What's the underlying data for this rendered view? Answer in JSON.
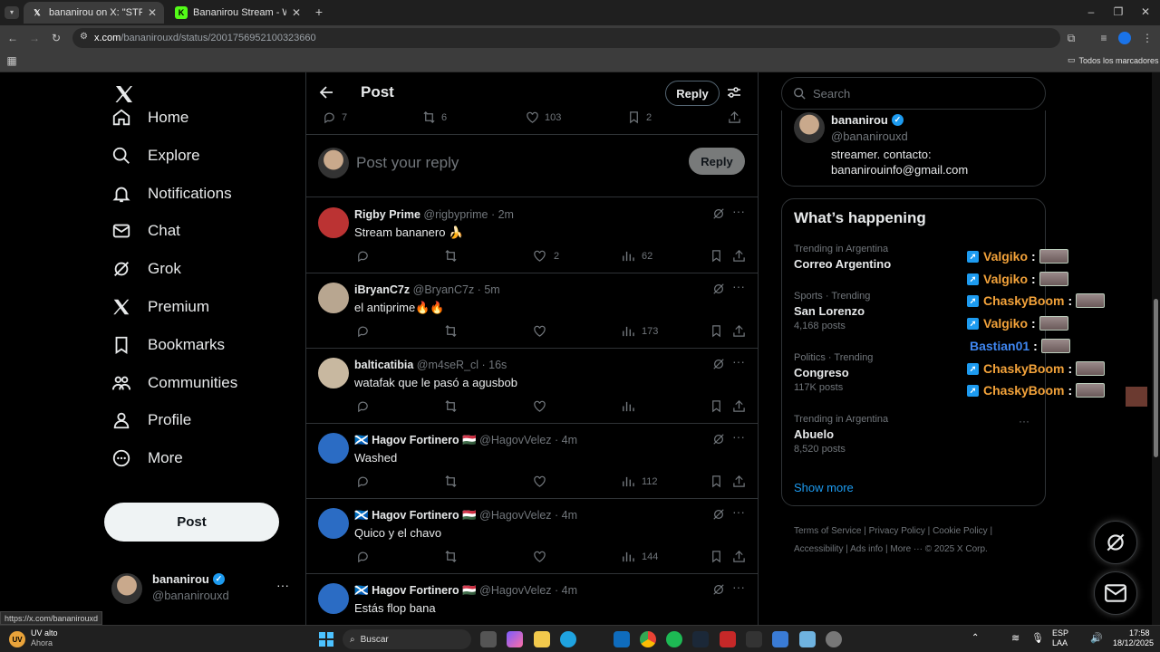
{
  "browser": {
    "tabs": [
      {
        "title": "bananirou on X: \"STREAM ON. I",
        "active": true
      },
      {
        "title": "Bananirou Stream - Watch Live",
        "active": false
      }
    ],
    "url_host": "x.com",
    "url_path": "/bananirouxd/status/2001756952100323660",
    "bookmarks_label": "Todos los marcadores",
    "status_url": "https://x.com/bananirouxd"
  },
  "nav": {
    "items": [
      {
        "label": "Home",
        "icon": "home-icon"
      },
      {
        "label": "Explore",
        "icon": "search-icon"
      },
      {
        "label": "Notifications",
        "icon": "bell-icon"
      },
      {
        "label": "Chat",
        "icon": "envelope-icon"
      },
      {
        "label": "Grok",
        "icon": "grok-icon"
      },
      {
        "label": "Premium",
        "icon": "x-logo-icon"
      },
      {
        "label": "Bookmarks",
        "icon": "bookmark-icon"
      },
      {
        "label": "Communities",
        "icon": "people-icon"
      },
      {
        "label": "Profile",
        "icon": "person-icon"
      },
      {
        "label": "More",
        "icon": "more-circle-icon"
      }
    ],
    "post_label": "Post",
    "user": {
      "name": "bananirou",
      "handle": "@bananirouxd"
    }
  },
  "header": {
    "title": "Post",
    "reply_label": "Reply"
  },
  "metrics": {
    "replies": "7",
    "reposts": "6",
    "likes": "103",
    "bookmarks": "2"
  },
  "compose": {
    "placeholder": "Post your reply",
    "button": "Reply"
  },
  "replies": [
    {
      "name": "Rigby Prime",
      "handle": "@rigbyprime",
      "time": "2m",
      "text": "Stream bananero 🍌",
      "replies": "",
      "reposts": "",
      "likes": "2",
      "views": "62",
      "avatar_color": "#b33"
    },
    {
      "name": "iBryanC7z",
      "handle": "@BryanC7z",
      "time": "5m",
      "text": "el antiprime🔥🔥",
      "replies": "",
      "reposts": "",
      "likes": "",
      "views": "173",
      "avatar_color": "#b8a690"
    },
    {
      "name": "balticatibia",
      "handle": "@m4seR_cl",
      "time": "16s",
      "text": "watafak que le pasó a agusbob",
      "replies": "",
      "reposts": "",
      "likes": "",
      "views": "",
      "avatar_color": "#c8b8a0"
    },
    {
      "name": "Hagov Fortinero",
      "prefix": "🏴󠁧󠁢󠁳󠁣󠁴󠁿",
      "flag": "🇭🇺",
      "handle": "@HagovVelez",
      "time": "4m",
      "text": "Washed",
      "replies": "",
      "reposts": "",
      "likes": "",
      "views": "112",
      "avatar_color": "#2b6cc4"
    },
    {
      "name": "Hagov Fortinero",
      "prefix": "🏴󠁧󠁢󠁳󠁣󠁴󠁿",
      "flag": "🇭🇺",
      "handle": "@HagovVelez",
      "time": "4m",
      "text": "Quico y el chavo",
      "replies": "",
      "reposts": "",
      "likes": "",
      "views": "144",
      "avatar_color": "#2b6cc4"
    },
    {
      "name": "Hagov Fortinero",
      "prefix": "🏴󠁧󠁢󠁳󠁣󠁴󠁿",
      "flag": "🇭🇺",
      "handle": "@HagovVelez",
      "time": "4m",
      "text": "Estás flop bana",
      "replies": "",
      "reposts": "",
      "likes": "",
      "views": "",
      "avatar_color": "#2b6cc4"
    }
  ],
  "right": {
    "search_placeholder": "Search",
    "profile": {
      "name": "bananirou",
      "handle": "@bananirouxd",
      "bio1": "streamer. contacto:",
      "bio2": "bananirouinfo@gmail.com"
    },
    "trends_title": "What’s happening",
    "trends": [
      {
        "meta": "Trending in Argentina",
        "topic": "Correo Argentino",
        "count": ""
      },
      {
        "meta": "Sports · Trending",
        "topic": "San Lorenzo",
        "count": "4,168 posts"
      },
      {
        "meta": "Politics · Trending",
        "topic": "Congreso",
        "count": "117K posts"
      },
      {
        "meta": "Trending in Argentina",
        "topic": "Abuelo",
        "count": "8,520 posts"
      }
    ],
    "show_more": "Show more",
    "footer": [
      "Terms of Service",
      "Privacy Policy",
      "Cookie Policy",
      "Accessibility",
      "Ads info",
      "More ···",
      "© 2025 X Corp."
    ]
  },
  "chat_overlay": [
    {
      "user": "Valgiko",
      "color": "#f2a23a",
      "badge": true
    },
    {
      "user": "Valgiko",
      "color": "#f2a23a",
      "badge": true
    },
    {
      "user": "ChaskyBoom",
      "color": "#f2a23a",
      "badge": true
    },
    {
      "user": "Valgiko",
      "color": "#f2a23a",
      "badge": true
    },
    {
      "user": "Bastian01",
      "color": "#3f86f0",
      "badge": false
    },
    {
      "user": "ChaskyBoom",
      "color": "#f2a23a",
      "badge": true
    },
    {
      "user": "ChaskyBoom",
      "color": "#f2a23a",
      "badge": true
    }
  ],
  "taskbar": {
    "weather": "UV alto",
    "weather_sub": "Ahora",
    "search": "Buscar",
    "lang": "ESP",
    "lang_sub": "LAA",
    "time": "17:58",
    "date": "18/12/2025"
  }
}
